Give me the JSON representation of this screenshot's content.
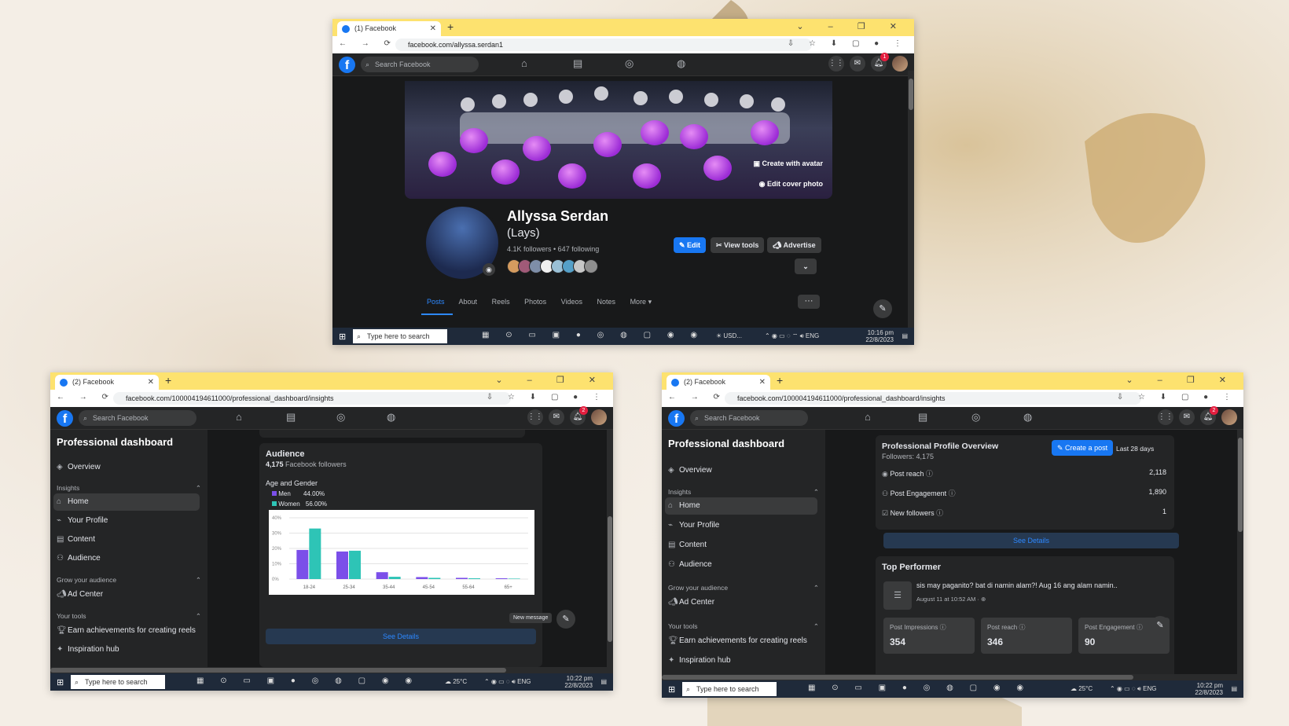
{
  "windows": {
    "profile": {
      "tab_title": "(1) Facebook",
      "url": "facebook.com/allyssa.serdan1",
      "search_placeholder": "Search Facebook",
      "notif_count": "1",
      "cover_avatar_label": "Create with avatar",
      "cover_photo_label": "Edit cover photo",
      "name": "Allyssa Serdan",
      "nickname": "(Lays)",
      "stats": "4.1K followers • 647 following",
      "edit_label": "Edit",
      "view_tools_label": "View tools",
      "advertise_label": "Advertise",
      "tabs": [
        "Posts",
        "About",
        "Reels",
        "Photos",
        "Videos",
        "Notes",
        "More ▾"
      ],
      "more_dots": "···",
      "taskbar": {
        "search": "Type here to search",
        "weather": "USD...",
        "lang": "ENG",
        "time": "10:16 pm",
        "date": "22/8/2023"
      }
    },
    "audience": {
      "tab_title": "(2) Facebook",
      "url": "facebook.com/100004194611000/professional_dashboard/insights",
      "search_placeholder": "Search Facebook",
      "notif_count": "2",
      "dashboard_title": "Professional dashboard",
      "overview": "Overview",
      "insights_header": "Insights",
      "home": "Home",
      "your_profile": "Your Profile",
      "content": "Content",
      "audience": "Audience",
      "grow_header": "Grow your audience",
      "ad_center": "Ad Center",
      "tools_header": "Your tools",
      "earn": "Earn achievements for creating reels",
      "inspiration": "Inspiration hub",
      "card_title": "Audience",
      "followers_count": "4,175",
      "followers_label": "Facebook followers",
      "age_gender_title": "Age and Gender",
      "see_details": "See Details",
      "new_message": "New message",
      "taskbar": {
        "search": "Type here to search",
        "weather": "25°C",
        "lang": "ENG",
        "time": "10:22 pm",
        "date": "22/8/2023"
      }
    },
    "overview": {
      "tab_title": "(2) Facebook",
      "url": "facebook.com/100004194611000/professional_dashboard/insights",
      "search_placeholder": "Search Facebook",
      "notif_count": "2",
      "dashboard_title": "Professional dashboard",
      "overview": "Overview",
      "insights_header": "Insights",
      "home": "Home",
      "your_profile": "Your Profile",
      "content": "Content",
      "audience": "Audience",
      "grow_header": "Grow your audience",
      "ad_center": "Ad Center",
      "tools_header": "Your tools",
      "earn": "Earn achievements for creating reels",
      "inspiration": "Inspiration hub",
      "ppo_title": "Professional Profile Overview",
      "ppo_followers": "Followers: 4,175",
      "create_post": "Create a post",
      "period": "Last 28 days",
      "rows": [
        {
          "label": "Post reach",
          "value": "2,118"
        },
        {
          "label": "Post Engagement",
          "value": "1,890"
        },
        {
          "label": "New followers",
          "value": "1"
        }
      ],
      "see_details": "See Details",
      "top_title": "Top Performer",
      "top_post_text": "sis may paganito? bat di namin alam?! Aug 16 ang alam namin..",
      "top_post_date": "August 11 at 10:52 AM · ",
      "metrics": [
        {
          "label": "Post Impressions",
          "value": "354"
        },
        {
          "label": "Post reach",
          "value": "346"
        },
        {
          "label": "Post Engagement",
          "value": "90"
        }
      ],
      "taskbar": {
        "search": "Type here to search",
        "weather": "25°C",
        "lang": "ENG",
        "time": "10:22 pm",
        "date": "22/8/2023"
      }
    }
  },
  "chart_data": {
    "type": "bar",
    "categories": [
      "18-24",
      "25-34",
      "35-44",
      "45-54",
      "55-64",
      "65+"
    ],
    "series": [
      {
        "name": "Men",
        "percent": "44.00%",
        "color": "#7b4fe9",
        "values": [
          19,
          18,
          4.5,
          1.3,
          0.8,
          0.5
        ]
      },
      {
        "name": "Women",
        "percent": "56.00%",
        "color": "#2ec4b6",
        "values": [
          33,
          18.5,
          1.5,
          0.8,
          0.5,
          0.3
        ]
      }
    ],
    "yticks": [
      "40%",
      "30%",
      "20%",
      "10%",
      "0%"
    ],
    "ylim": [
      0,
      40
    ],
    "grid": true
  }
}
